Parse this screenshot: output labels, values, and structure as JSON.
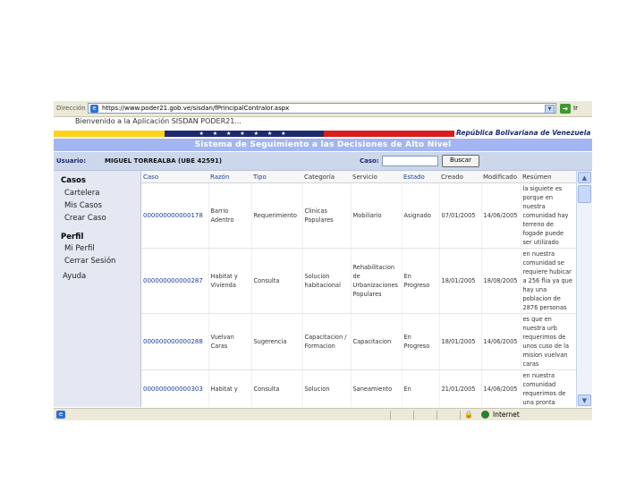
{
  "browser": {
    "address_label": "Dirección",
    "url": "https://www.poder21.gob.ve/sisdan/fPrincipalContralor.aspx",
    "go_label": "Ir",
    "status_zone": "Internet"
  },
  "header": {
    "welcome": "Bienvenido a la Aplicación SISDAN PODER21...",
    "stars": "★ ★ ★ ★ ★ ★ ★",
    "country": "República Bolivariana de Venezuela",
    "system_title": "Sistema de Seguimiento a las Decisiones de Alto Nivel",
    "user_label": "Usuario:",
    "user_name": "MIGUEL TORREALBA (UBE 42591)",
    "case_label": "Caso:",
    "case_value": "",
    "search_button": "Buscar"
  },
  "sidebar": {
    "casos_heading": "Casos",
    "casos_items": [
      "Cartelera",
      "Mis Casos",
      "Crear Caso"
    ],
    "perfil_heading": "Perfil",
    "perfil_items": [
      "Mi Perfil",
      "Cerrar Sesión"
    ],
    "ayuda": "Ayuda"
  },
  "table": {
    "columns": [
      "Caso",
      "Razón",
      "Tipo",
      "Categoría",
      "Servicio",
      "Estado",
      "Creado",
      "Modificado",
      "Resúmen"
    ],
    "rows": [
      {
        "caso": "000000000000178",
        "razon": "Barrio Adentro",
        "tipo": "Requerimiento",
        "categoria": "Clinicas Populares",
        "servicio": "Mobiliario",
        "estado": "Asignado",
        "creado": "07/01/2005",
        "modificado": "14/06/2005",
        "resumen": "la siguiete es porque en nuestra comunidad hay terreno de fogade puede ser utilizado"
      },
      {
        "caso": "000000000000287",
        "razon": "Habitat y Vivienda",
        "tipo": "Consulta",
        "categoria": "Solucion habitacional",
        "servicio": "Rehabilitacion de Urbanizaciones Populares",
        "estado": "En Progreso",
        "creado": "18/01/2005",
        "modificado": "18/08/2005",
        "resumen": "en nuestra comunidad se requiere hubicar a 256 flia ya que hay una poblacion de 2876 personas"
      },
      {
        "caso": "000000000000288",
        "razon": "Vuelvan Caras",
        "tipo": "Sugerencia",
        "categoria": "Capacitacion / Formacion",
        "servicio": "Capacitacion",
        "estado": "En Progreso",
        "creado": "18/01/2005",
        "modificado": "14/06/2005",
        "resumen": "es que en nuestra urb requerimos de unos cuso de la mision vuelvan caras"
      },
      {
        "caso": "000000000000303",
        "razon": "Habitat y",
        "tipo": "Consulta",
        "categoria": "Solucion",
        "servicio": "Saneamiento",
        "estado": "En",
        "creado": "21/01/2005",
        "modificado": "14/06/2005",
        "resumen": "en nuestra comunidad requerimos de una pronta"
      }
    ]
  },
  "colors": {
    "title_bar": "#a3b6f1",
    "user_bar": "#ccd7ec",
    "sidebar_bg": "#e4e8f2",
    "link_blue": "#1a3d99",
    "flag_yellow": "#ffd21a",
    "flag_blue": "#1e2a6e",
    "flag_red": "#d81d1d"
  },
  "icons": [
    "ie-page-icon",
    "dropdown-icon",
    "go-arrow-icon",
    "scroll-up-icon",
    "scroll-down-icon",
    "lock-icon",
    "globe-icon"
  ]
}
